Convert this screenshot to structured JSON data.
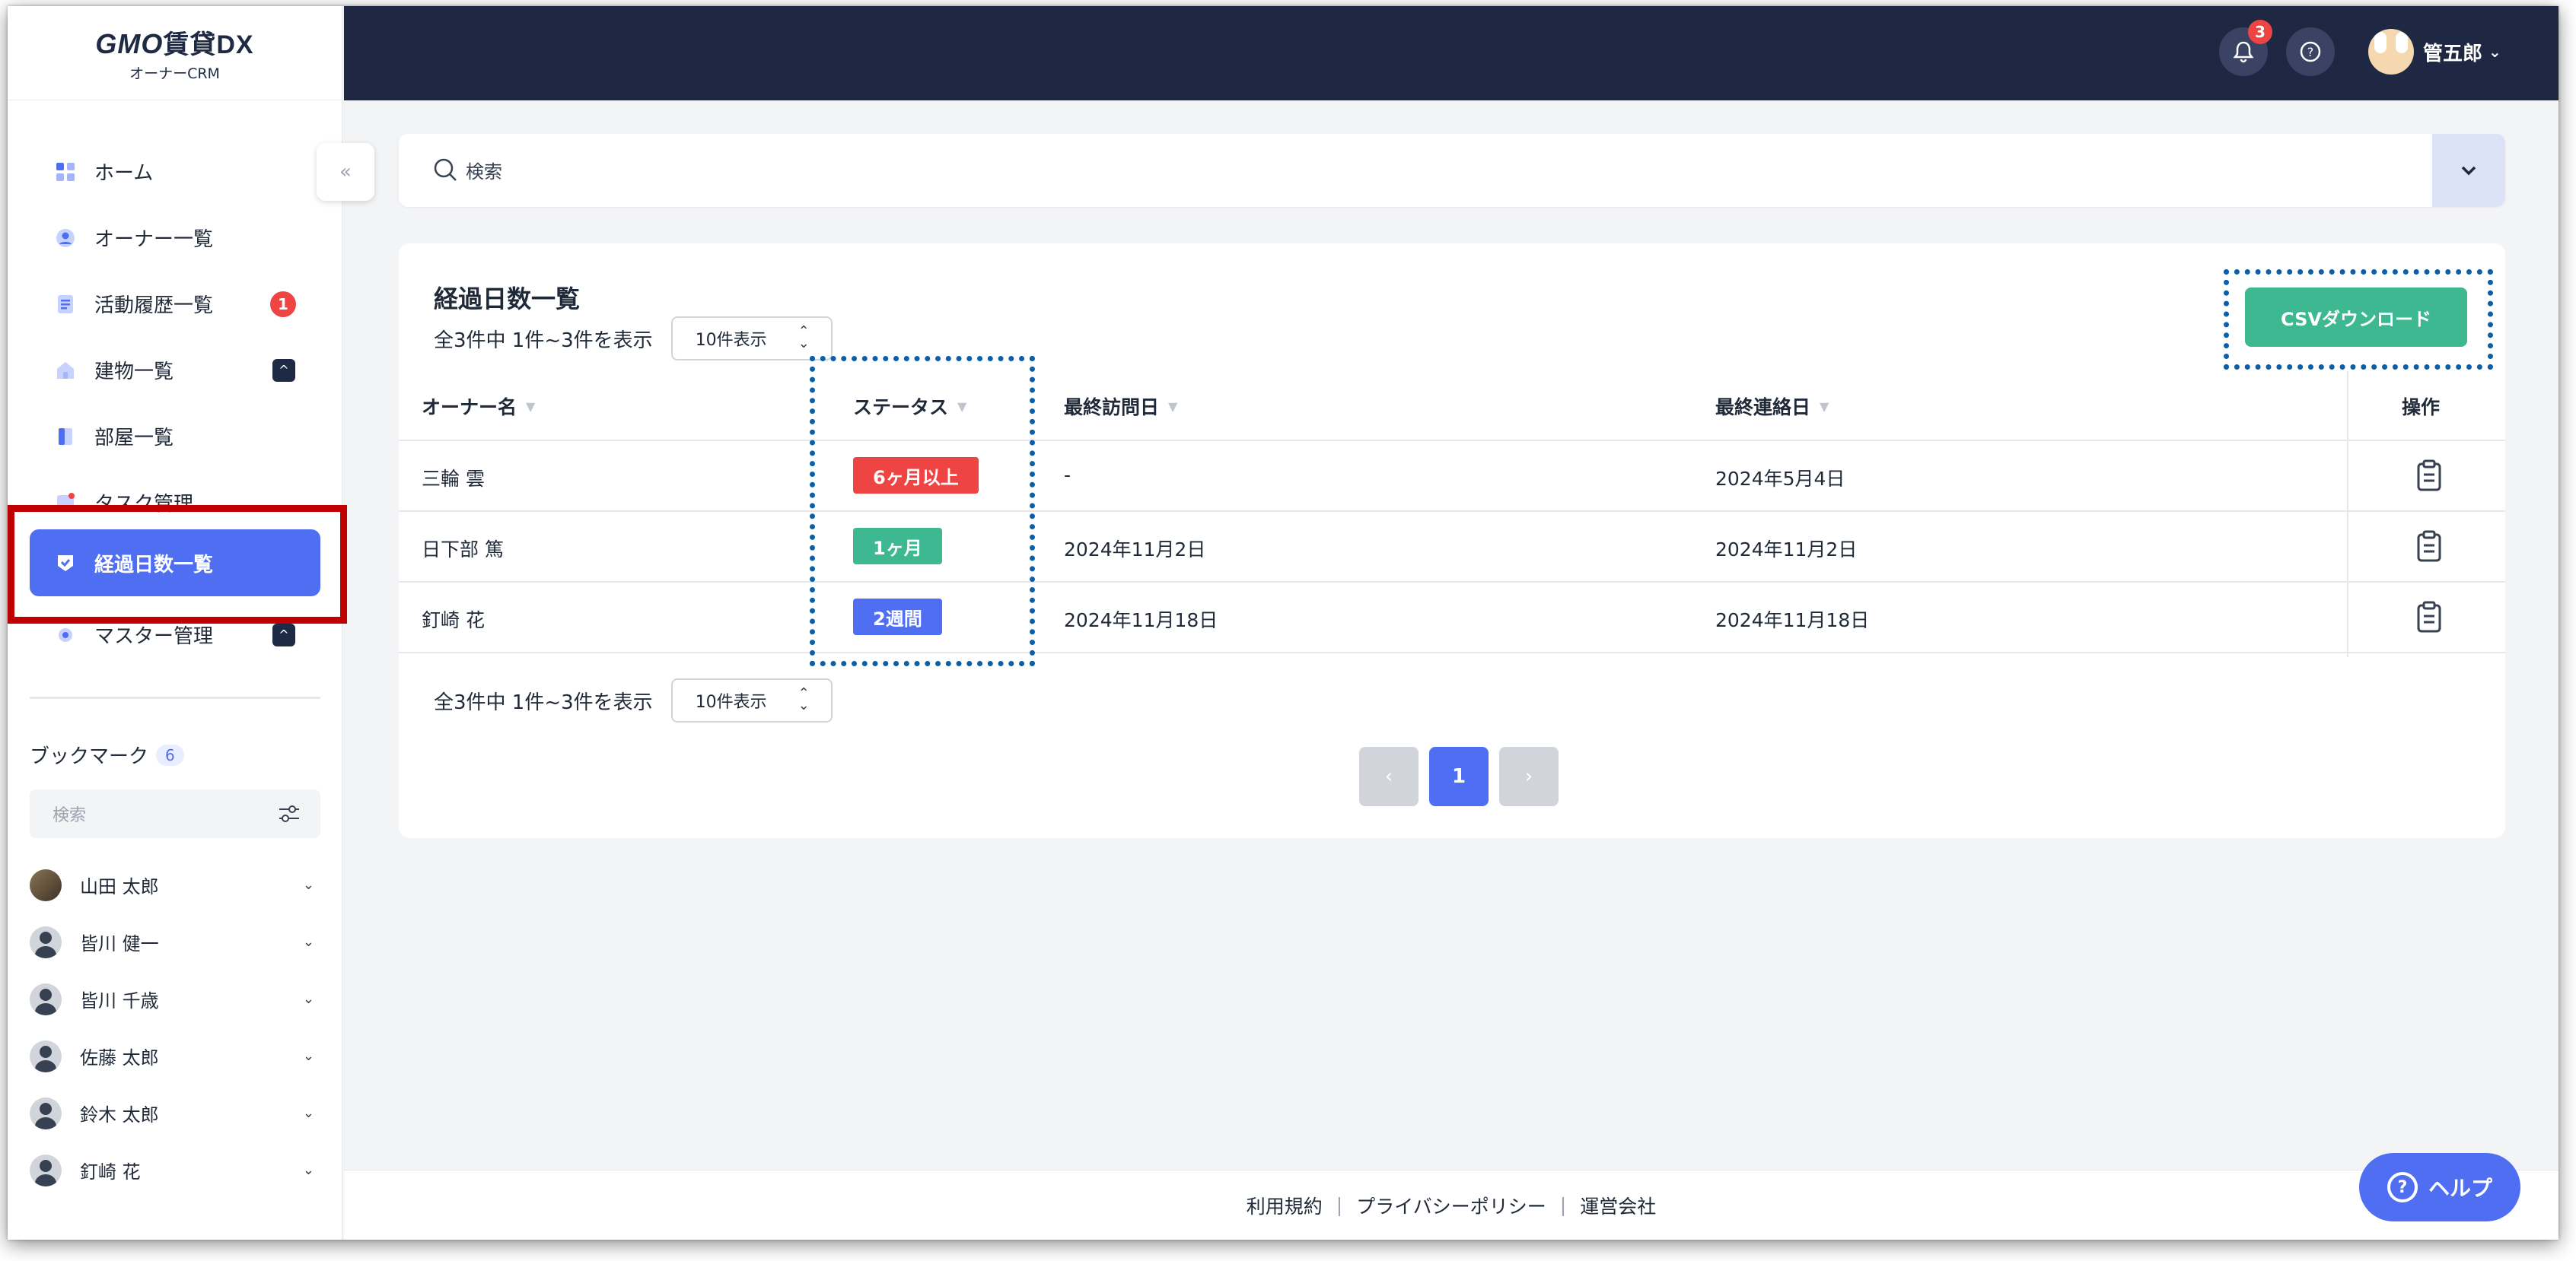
{
  "logo": {
    "brand": "GMO",
    "product": "賃貸DX",
    "subtitle": "オーナーCRM"
  },
  "sidebar": {
    "items": [
      {
        "label": "ホーム",
        "icon": "grid-icon"
      },
      {
        "label": "オーナー一覧",
        "icon": "user-circle-icon"
      },
      {
        "label": "活動履歴一覧",
        "icon": "document-icon",
        "badge": "1"
      },
      {
        "label": "建物一覧",
        "icon": "building-icon",
        "toggle": "^"
      },
      {
        "label": "部屋一覧",
        "icon": "room-icon"
      },
      {
        "label": "タスク管理",
        "icon": "task-icon"
      },
      {
        "label": "経過日数一覧",
        "icon": "check-shield-icon",
        "active": true
      },
      {
        "label": "マスター管理",
        "icon": "settings-icon",
        "toggle": "^"
      }
    ],
    "bookmark_title": "ブックマーク",
    "bookmark_count": "6",
    "bookmark_search_placeholder": "検索",
    "bookmarks": [
      "山田 太郎",
      "皆川 健一",
      "皆川 千歳",
      "佐藤 太郎",
      "鈴木 太郎",
      "釘崎 花"
    ]
  },
  "header": {
    "notification_count": "3",
    "user_name": "管五郎"
  },
  "search": {
    "placeholder": "検索"
  },
  "main": {
    "title": "経過日数一覧",
    "count_text": "全3件中 1件~3件を表示",
    "page_size": "10件表示",
    "csv_label": "CSVダウンロード",
    "columns": [
      "オーナー名",
      "ステータス",
      "最終訪問日",
      "最終連絡日",
      "操作"
    ],
    "rows": [
      {
        "owner": "三輪 雲",
        "status": "6ヶ月以上",
        "status_color": "#ef4444",
        "last_visit": "-",
        "last_contact": "2024年5月4日"
      },
      {
        "owner": "日下部 篤",
        "status": "1ヶ月",
        "status_color": "#3db890",
        "last_visit": "2024年11月2日",
        "last_contact": "2024年11月2日"
      },
      {
        "owner": "釘崎 花",
        "status": "2週間",
        "status_color": "#4f6ef2",
        "last_visit": "2024年11月18日",
        "last_contact": "2024年11月18日"
      }
    ],
    "pagination": {
      "prev": "‹",
      "current": "1",
      "next": "›"
    }
  },
  "footer": {
    "links": [
      "利用規約",
      "プライバシーポリシー",
      "運営会社"
    ]
  },
  "help": {
    "label": "ヘルプ"
  },
  "colors": {
    "accent": "#4f6ef2",
    "header_bg": "#1f2842",
    "csv": "#3db890",
    "highlight_red": "#c00000",
    "highlight_blue": "#0b5ea8"
  }
}
